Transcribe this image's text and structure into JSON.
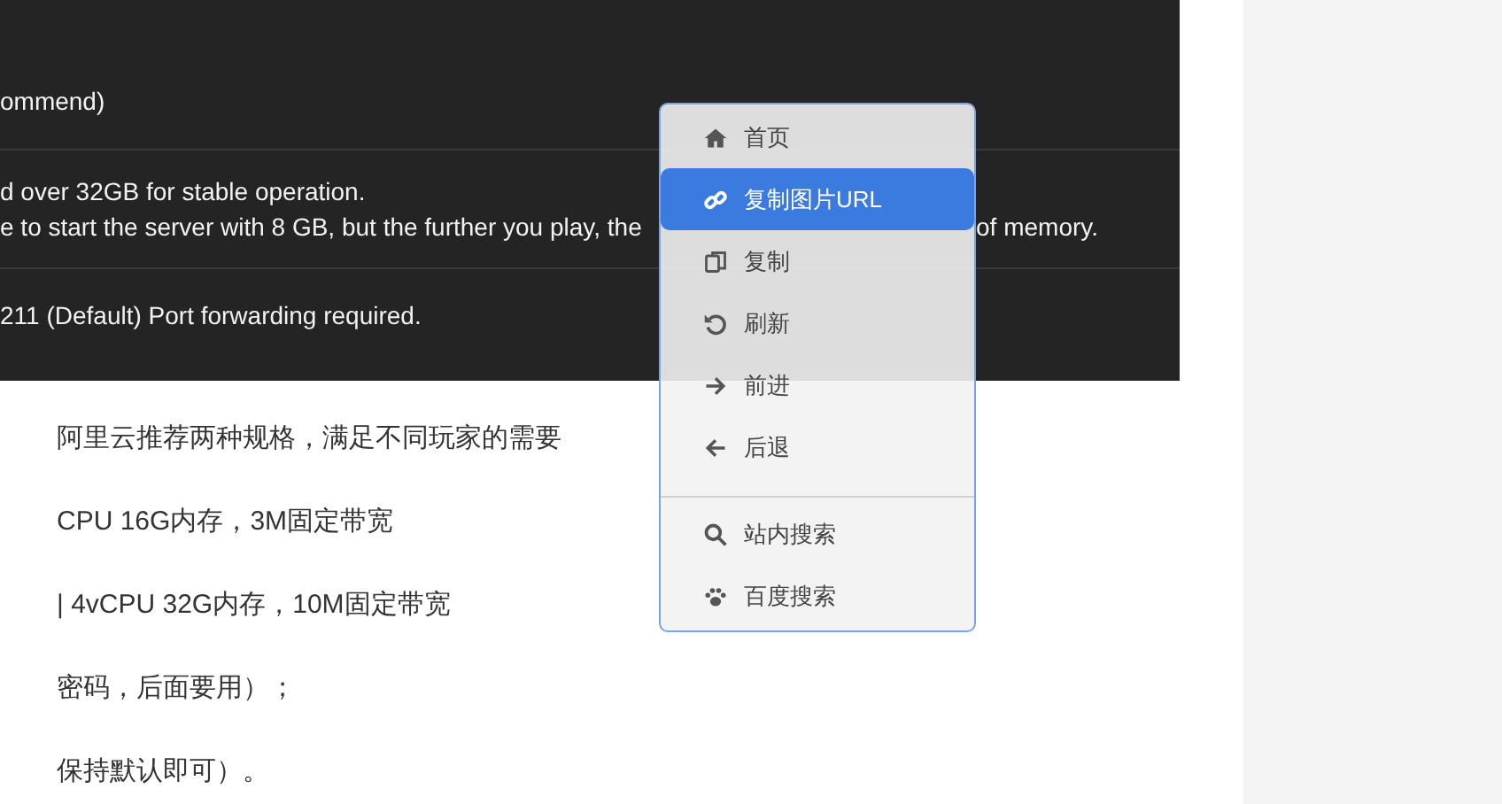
{
  "table": {
    "rows": [
      {
        "lines": [
          "ommend)"
        ]
      },
      {
        "lines": [
          "d over 32GB for stable operation.",
          "e to start the server with 8 GB, but the further you play, the"
        ],
        "tail": "of memory."
      },
      {
        "lines": [
          "211 (Default) Port forwarding required."
        ]
      }
    ]
  },
  "paragraphs": [
    "阿里云推荐两种规格，满足不同玩家的需要",
    "CPU 16G内存，3M固定带宽",
    "| 4vCPU 32G内存，10M固定带宽",
    "密码，后面要用）；",
    "保持默认即可）。"
  ],
  "context_menu": {
    "groups": [
      [
        {
          "label": "首页",
          "selected": false
        },
        {
          "label": "复制图片URL",
          "selected": true
        },
        {
          "label": "复制",
          "selected": false
        },
        {
          "label": "刷新",
          "selected": false
        },
        {
          "label": "前进",
          "selected": false
        },
        {
          "label": "后退",
          "selected": false
        }
      ],
      [
        {
          "label": "站内搜索",
          "selected": false
        },
        {
          "label": "百度搜索",
          "selected": false
        }
      ]
    ]
  }
}
